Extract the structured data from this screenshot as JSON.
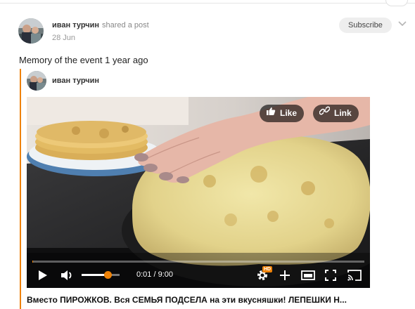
{
  "post": {
    "author": "иван турчин",
    "action": "shared a post",
    "date": "28 Jun",
    "subscribe_label": "Subscribe",
    "memory_text": "Memory of the event 1 year ago"
  },
  "shared": {
    "author": "иван турчин",
    "video": {
      "like_label": "Like",
      "link_label": "Link",
      "time": "0:01 / 9:00",
      "hd_badge": "HD",
      "progress": 0.003,
      "volume": 0.68
    },
    "title": "Вместо ПИРОЖКОВ. Вся СЕМЬЯ ПОДСЕЛА на эти вкусняшки! ЛЕПЕШКИ Н..."
  },
  "colors": {
    "accent": "#ee8208",
    "subscribe_bg": "#eeeeee"
  }
}
